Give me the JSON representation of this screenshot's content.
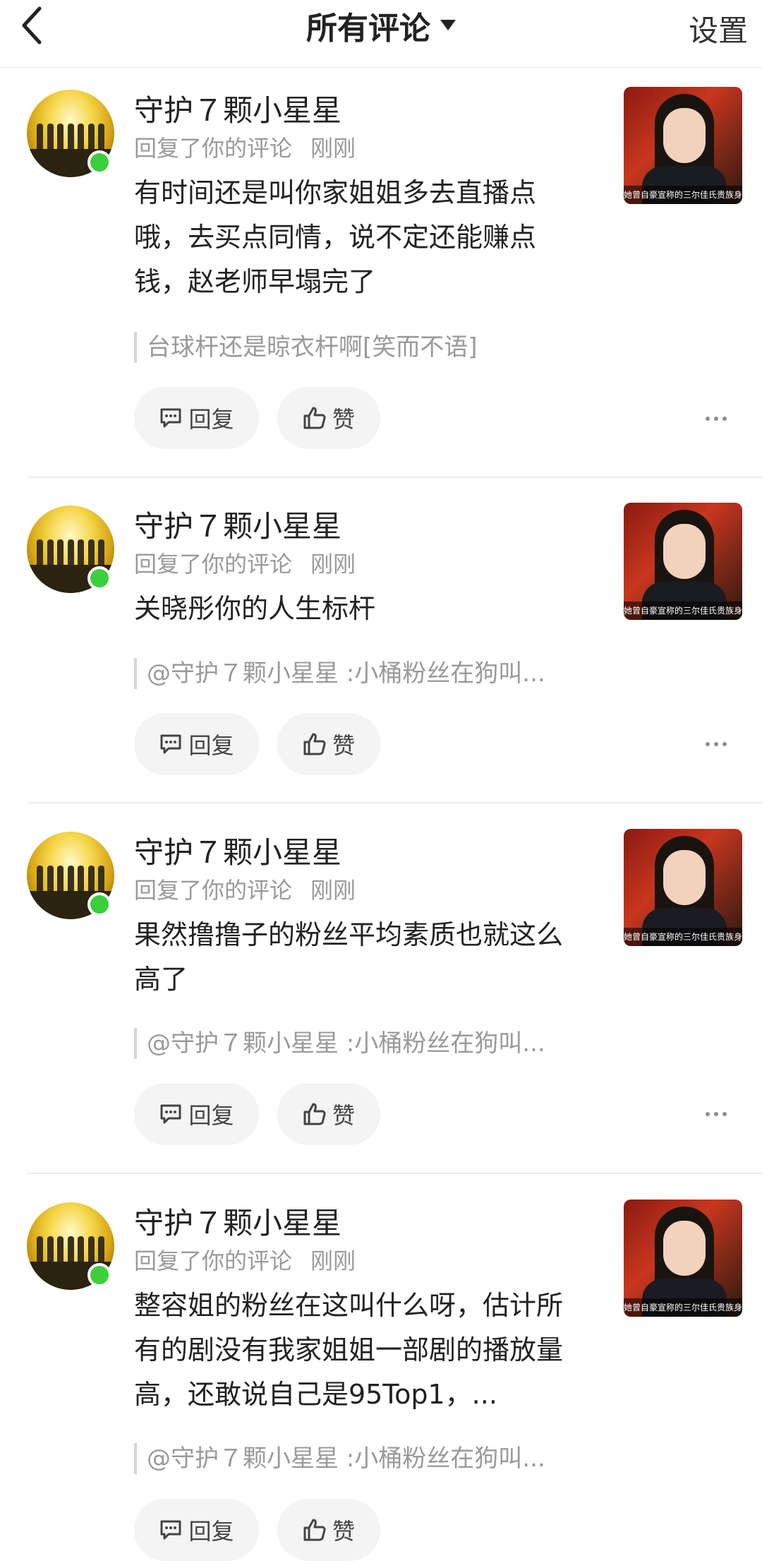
{
  "header": {
    "title": "所有评论",
    "settings_label": "设置"
  },
  "comments": [
    {
      "user_name": "守护７颗小星星",
      "action": "回复了你的评论",
      "time": "刚刚",
      "content": "有时间还是叫你家姐姐多去直播点哦，去买点同情，说不定还能赚点钱，赵老师早塌完了",
      "quote": "台球杆还是晾衣杆啊[笑而不语]",
      "thumb_caption": "她曾自豪宣称的三尔佳氏贵族身份",
      "reply_label": "回复",
      "like_label": "赞"
    },
    {
      "user_name": "守护７颗小星星",
      "action": "回复了你的评论",
      "time": "刚刚",
      "content": "关晓彤你的人生标杆",
      "quote": "@守护７颗小星星 :小桶粉丝在狗叫...",
      "thumb_caption": "她曾自豪宣称的三尔佳氏贵族身份",
      "reply_label": "回复",
      "like_label": "赞"
    },
    {
      "user_name": "守护７颗小星星",
      "action": "回复了你的评论",
      "time": "刚刚",
      "content": "果然撸撸子的粉丝平均素质也就这么高了",
      "quote": "@守护７颗小星星 :小桶粉丝在狗叫...",
      "thumb_caption": "她曾自豪宣称的三尔佳氏贵族身份",
      "reply_label": "回复",
      "like_label": "赞"
    },
    {
      "user_name": "守护７颗小星星",
      "action": "回复了你的评论",
      "time": "刚刚",
      "content": "整容姐的粉丝在这叫什么呀，估计所有的剧没有我家姐姐一部剧的播放量高，还敢说自己是95Top1，...",
      "quote": "@守护７颗小星星 :小桶粉丝在狗叫...",
      "thumb_caption": "她曾自豪宣称的三尔佳氏贵族身份",
      "reply_label": "回复",
      "like_label": "赞"
    }
  ]
}
